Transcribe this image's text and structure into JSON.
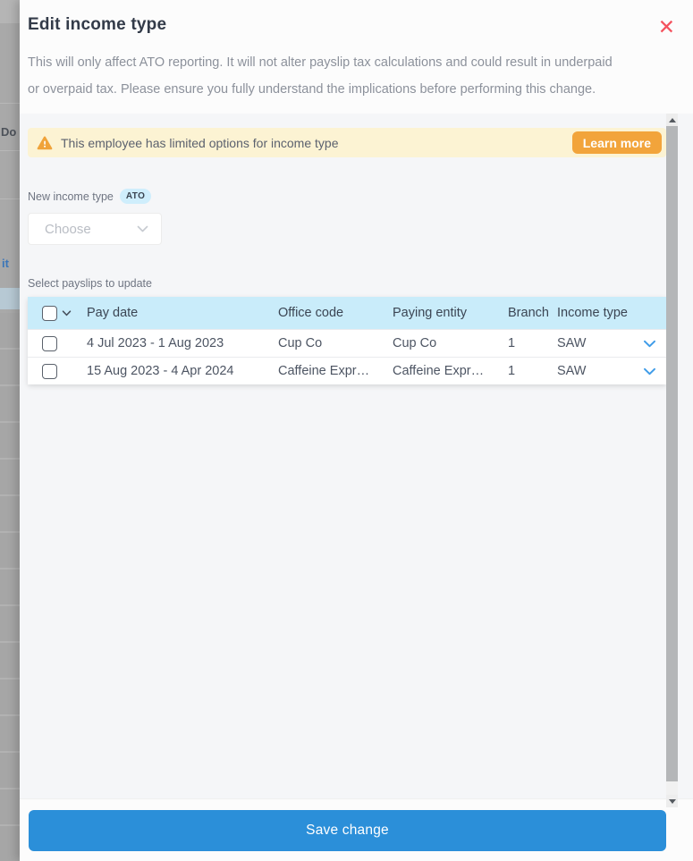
{
  "modal": {
    "title": "Edit income type",
    "close_icon": "✕",
    "description_line1": "This will only affect ATO reporting. It will not alter payslip tax calculations and could result in underpaid",
    "description_line2": "or overpaid tax. Please ensure you fully understand the implications before performing this change."
  },
  "warning": {
    "message": "This employee has limited options for income type",
    "learn_more_label": "Learn more"
  },
  "income_type_field": {
    "label": "New income type",
    "badge": "ATO",
    "dropdown_value": "Choose"
  },
  "payslips": {
    "label": "Select payslips to update",
    "columns": [
      "Pay date",
      "Office code",
      "Paying entity",
      "Branch",
      "Income type"
    ],
    "rows": [
      {
        "pay_date": "4 Jul 2023 - 1 Aug 2023",
        "office_code": "Cup Co",
        "paying_entity": "Cup Co",
        "branch": "1",
        "income_type": "SAW"
      },
      {
        "pay_date": "15 Aug 2023 - 4 Apr 2024",
        "office_code": "Caffeine Expr…",
        "paying_entity": "Caffeine Expr…",
        "branch": "1",
        "income_type": "SAW"
      }
    ]
  },
  "footer": {
    "save_label": "Save change"
  },
  "background_page": {
    "partial_text_1": "Do",
    "partial_text_2": "it"
  },
  "colors": {
    "save_button_blue": "#2b8fd9",
    "table_header_blue": "#c9ecfa",
    "warning_background": "#fcf3d3",
    "warning_orange": "#f2a43b",
    "badge_blue": "#cfeefc",
    "close_red": "#f4525e",
    "row_chevron_blue": "#3f9ce8",
    "modal_body_gray": "#f5f6f8"
  }
}
